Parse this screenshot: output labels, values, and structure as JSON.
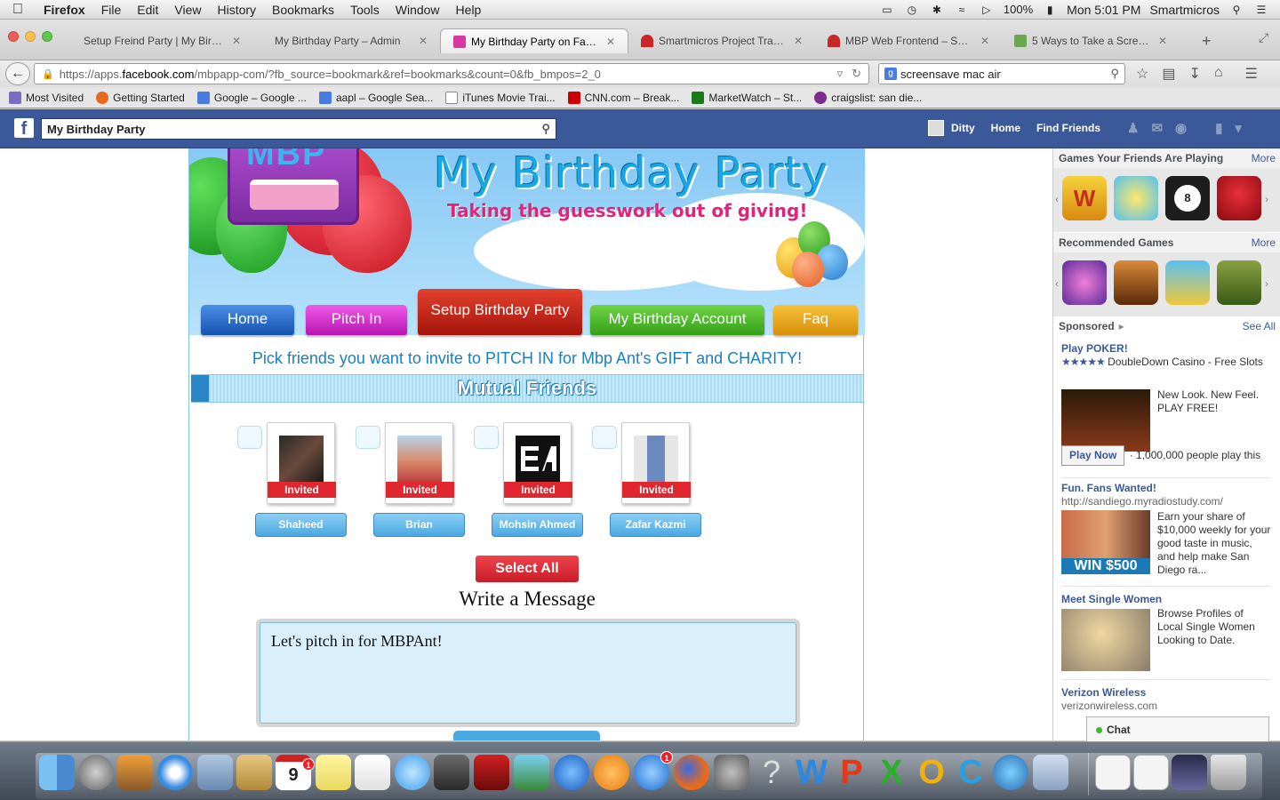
{
  "menubar": {
    "app": "Firefox",
    "items": [
      "File",
      "Edit",
      "View",
      "History",
      "Bookmarks",
      "Tools",
      "Window",
      "Help"
    ],
    "battery": "100%",
    "clock": "Mon 5:01 PM",
    "user": "Smartmicros"
  },
  "tabs": [
    {
      "title": "Setup Freind Party | My Birthd...",
      "color": "#e8e8e8"
    },
    {
      "title": "My Birthday Party – Admin",
      "color": "#e8e8e8"
    },
    {
      "title": "My Birthday Party on Face...",
      "color": "#d63aa0"
    },
    {
      "title": "Smartmicros Project Track...",
      "color": "#c82828"
    },
    {
      "title": "MBP Web Frontend – Smar...",
      "color": "#c82828"
    },
    {
      "title": "5 Ways to Take a Screens...",
      "color": "#6aa84f"
    }
  ],
  "url": {
    "prefix": "https://apps.",
    "domain": "facebook.com",
    "path": "/mbpapp-com/?fb_source=bookmark&ref=bookmarks&count=0&fb_bmpos=2_0"
  },
  "search_engine_query": "screensave mac air",
  "bookmarks": [
    {
      "label": "Most Visited",
      "color": "#7a6ec2"
    },
    {
      "label": "Getting Started",
      "color": "#e66a1f"
    },
    {
      "label": "Google – Google ...",
      "color": "#4a7be0"
    },
    {
      "label": "aapl – Google Sea...",
      "color": "#4a7be0"
    },
    {
      "label": "iTunes Movie Trai...",
      "color": "#888888"
    },
    {
      "label": "CNN.com – Break...",
      "color": "#cc0000"
    },
    {
      "label": "MarketWatch – St...",
      "color": "#1a7a1a"
    },
    {
      "label": "craigslist: san die...",
      "color": "#7b2c8c"
    }
  ],
  "facebook": {
    "search_value": "My Birthday Party",
    "user": "Ditty",
    "home": "Home",
    "find_friends": "Find Friends"
  },
  "app": {
    "logo_text": "MBP",
    "title": "My Birthday Party",
    "tagline": "Taking the guesswork out of giving!",
    "nav": {
      "home": "Home",
      "pitch": "Pitch In",
      "setup": "Setup Birthday Party",
      "account": "My Birthday Account",
      "faq": "Faq"
    },
    "instruction": "Pick friends you want to invite to PITCH IN for Mbp Ant's GIFT and CHARITY!",
    "mutual_friends_label": "Mutual Friends",
    "friends": [
      {
        "name": "Shaheed",
        "status": "Invited"
      },
      {
        "name": "Brian",
        "status": "Invited"
      },
      {
        "name": "Mohsin Ahmed",
        "status": "Invited"
      },
      {
        "name": "Zafar Kazmi",
        "status": "Invited"
      }
    ],
    "select_all": "Select All",
    "write_message": "Write a Message",
    "message_value": "Let's pitch in for MBPAnt!"
  },
  "sidebar": {
    "games_header": "Games Your Friends Are Playing",
    "more": "More",
    "recommended_header": "Recommended Games",
    "sponsored": "Sponsored",
    "see_all": "See All",
    "ads": [
      {
        "title": "Play POKER!",
        "stars": "★★★★★",
        "sub": "DoubleDown Casino - Free Slots",
        "desc": "New Look. New Feel. PLAY FREE!",
        "button": "Play Now",
        "social": "· 1,000,000 people play this"
      },
      {
        "title": "Fun. Fans Wanted!",
        "url": "http://sandiego.myradiostudy.com/",
        "desc": "Earn your share of $10,000 weekly for your good taste in music, and help make San Diego ra...",
        "img_text": "WIN $500"
      },
      {
        "title": "Meet Single Women",
        "desc": "Browse Profiles of Local Single Women Looking to Date."
      },
      {
        "title": "Verizon Wireless",
        "url": "verizonwireless.com"
      }
    ],
    "chat": "Chat"
  },
  "dock": {
    "badges": [
      "1",
      "1"
    ]
  }
}
